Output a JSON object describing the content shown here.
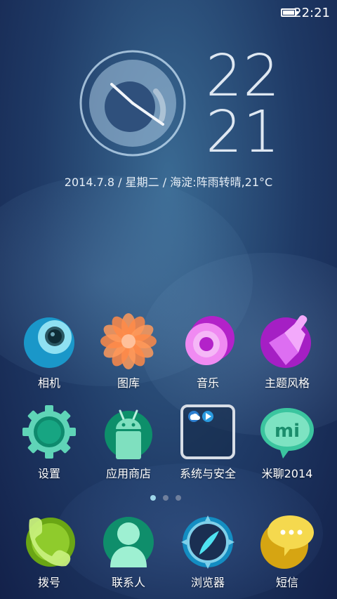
{
  "status_bar": {
    "time": "22:21",
    "battery_icon": "battery-icon"
  },
  "clock": {
    "hour": "22",
    "minute": "21",
    "date_line": "2014.7.8  / 星期二 / 海淀:阵雨转晴,21°C"
  },
  "apps_row1": [
    {
      "label": "相机",
      "icon": "camera-icon"
    },
    {
      "label": "图库",
      "icon": "gallery-icon"
    },
    {
      "label": "音乐",
      "icon": "music-icon"
    },
    {
      "label": "主题风格",
      "icon": "theme-brush-icon"
    }
  ],
  "apps_row2": [
    {
      "label": "设置",
      "icon": "settings-gear-icon"
    },
    {
      "label": "应用商店",
      "icon": "android-store-icon"
    },
    {
      "label": "系统与安全",
      "icon": "folder-icon"
    },
    {
      "label": "米聊2014",
      "icon": "mi-chat-icon"
    }
  ],
  "dock": [
    {
      "label": "拨号",
      "icon": "phone-icon"
    },
    {
      "label": "联系人",
      "icon": "contacts-icon"
    },
    {
      "label": "浏览器",
      "icon": "browser-compass-icon"
    },
    {
      "label": "短信",
      "icon": "sms-icon"
    }
  ],
  "page_indicator": {
    "pages": 3,
    "active": 0
  },
  "colors": {
    "accent": "#9fd7ea",
    "background": "#1f3a66"
  }
}
